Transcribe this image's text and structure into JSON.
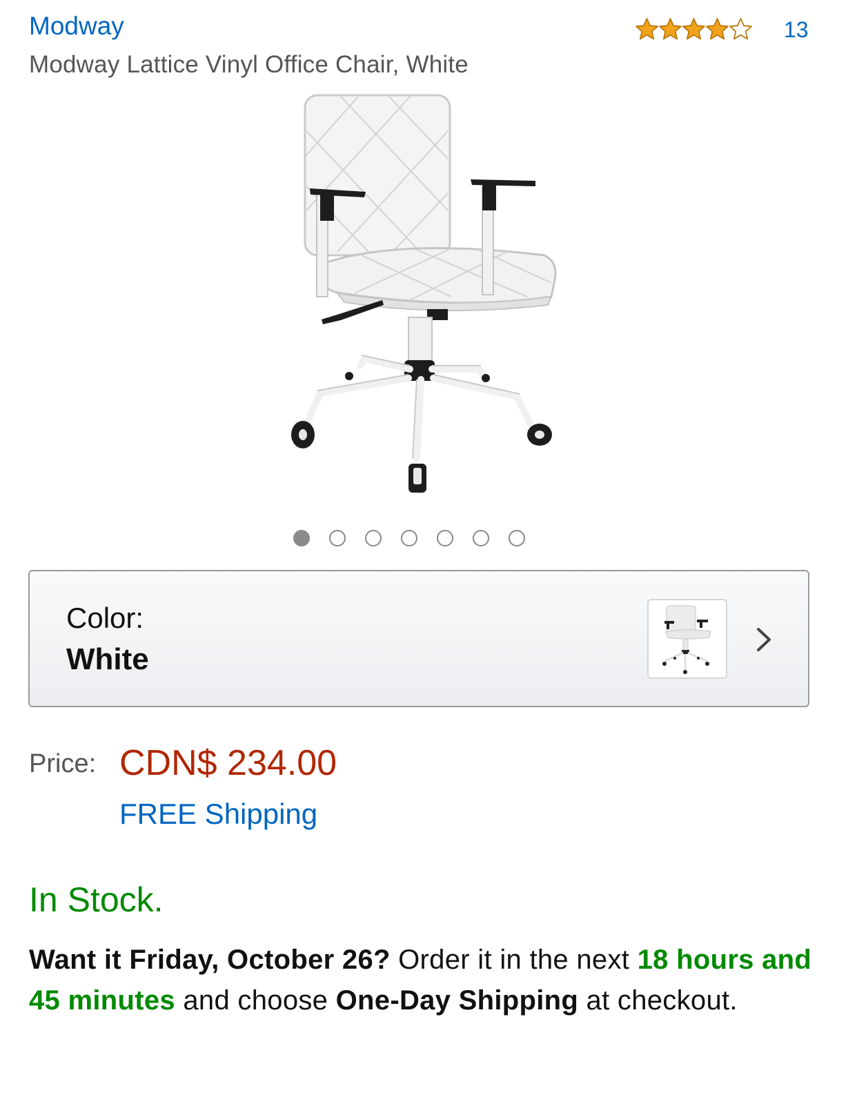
{
  "header": {
    "brand": "Modway",
    "title": "Modway Lattice Vinyl Office Chair, White",
    "rating": 4,
    "rating_max": 5,
    "review_count": "13"
  },
  "gallery": {
    "image_count": 7,
    "active_index": 0
  },
  "variation": {
    "label": "Color:",
    "value": "White"
  },
  "price": {
    "label": "Price:",
    "value": "CDN$ 234.00",
    "shipping": "FREE Shipping"
  },
  "availability": {
    "status": "In Stock."
  },
  "delivery": {
    "want_it": "Want it Friday, October 26?",
    "order_text": " Order it in the next ",
    "countdown": "18 hours and 45 minutes",
    "choose_text": " and choose ",
    "shipping_option": "One-Day Shipping",
    "suffix": " at checkout."
  },
  "colors": {
    "link": "#0066c0",
    "price": "#b12704",
    "in_stock": "#008a00",
    "star_fill": "#f2a31c"
  }
}
